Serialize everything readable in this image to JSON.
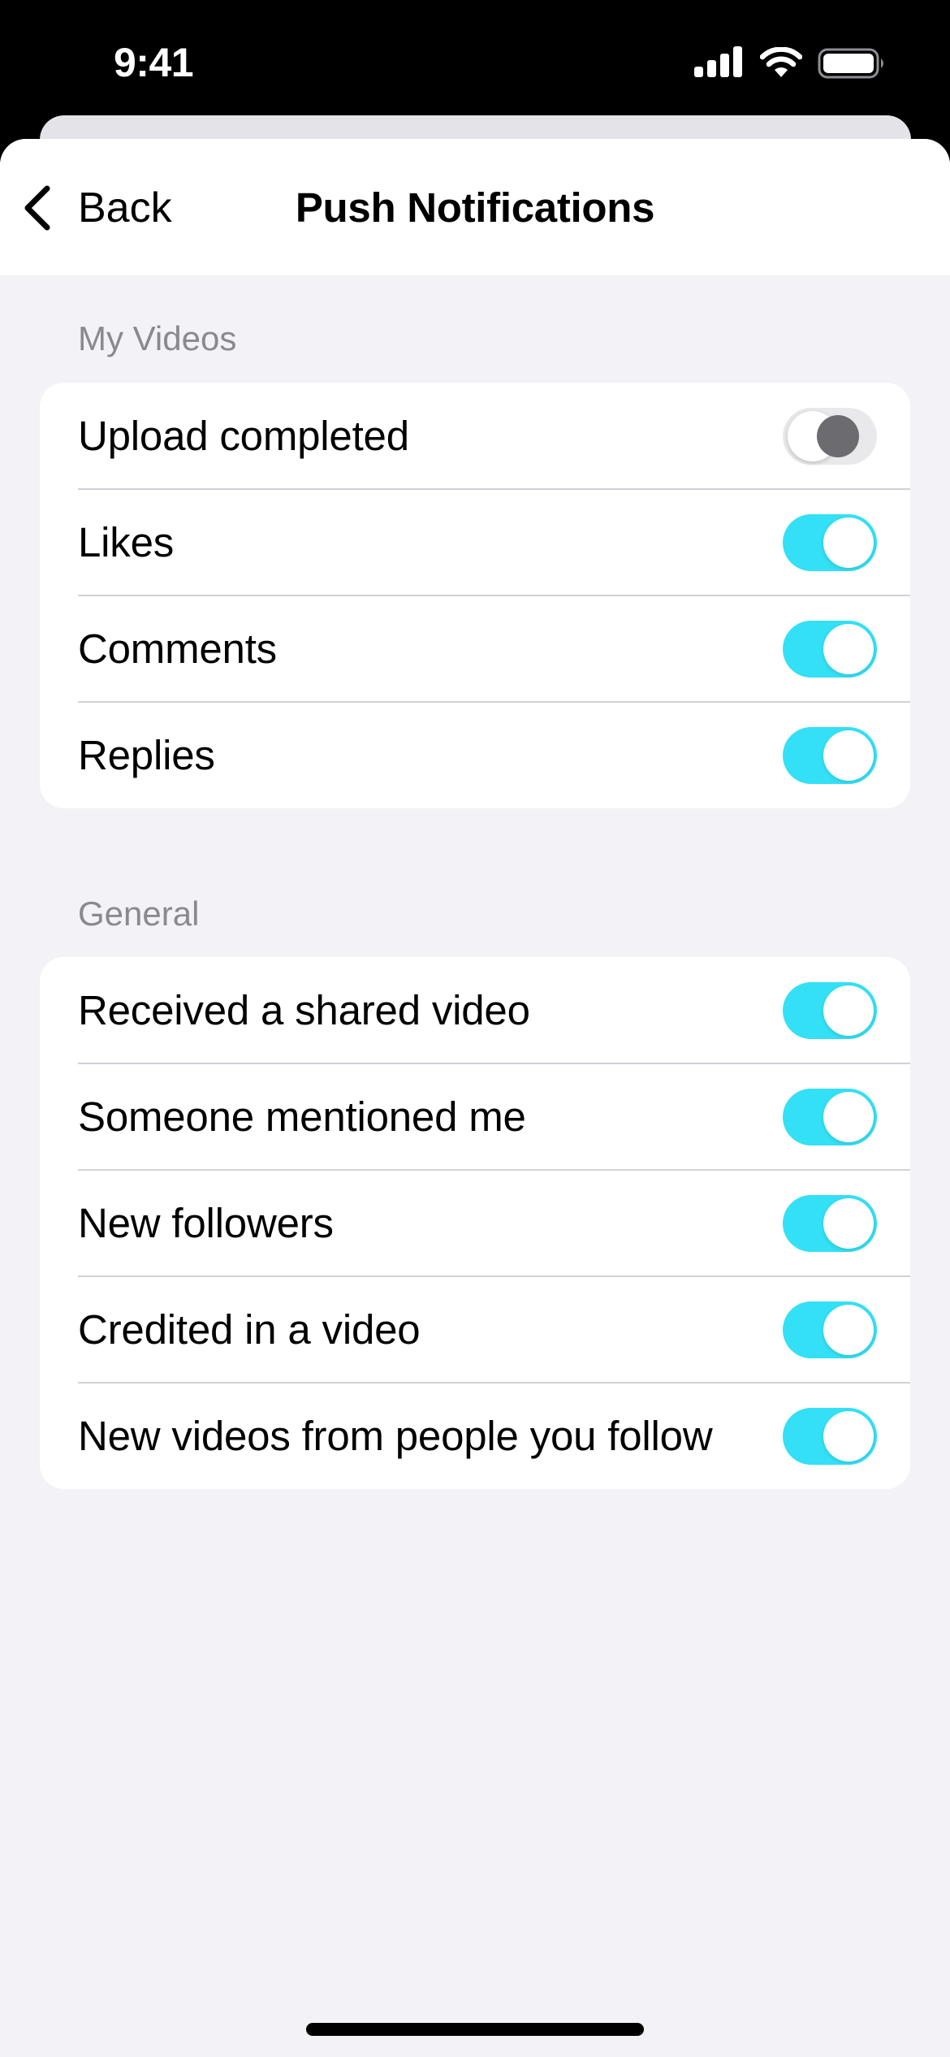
{
  "status_bar": {
    "time": "9:41",
    "icons": [
      "cellular-signal-icon",
      "wifi-icon",
      "battery-icon"
    ]
  },
  "nav": {
    "back_label": "Back",
    "title": "Push Notifications"
  },
  "sections": [
    {
      "header": "My Videos",
      "items": [
        {
          "label": "Upload completed",
          "enabled": false
        },
        {
          "label": "Likes",
          "enabled": true
        },
        {
          "label": "Comments",
          "enabled": true
        },
        {
          "label": "Replies",
          "enabled": true
        }
      ]
    },
    {
      "header": "General",
      "items": [
        {
          "label": "Received a shared video",
          "enabled": true
        },
        {
          "label": "Someone mentioned me",
          "enabled": true
        },
        {
          "label": "New followers",
          "enabled": true
        },
        {
          "label": "Credited in a video",
          "enabled": true
        },
        {
          "label": "New videos from people you follow",
          "enabled": true
        }
      ]
    }
  ],
  "colors": {
    "toggle_on": "#33e0f5",
    "toggle_off": "#e9e9eb",
    "background": "#f2f2f7",
    "section_header": "#8a8a8e"
  }
}
